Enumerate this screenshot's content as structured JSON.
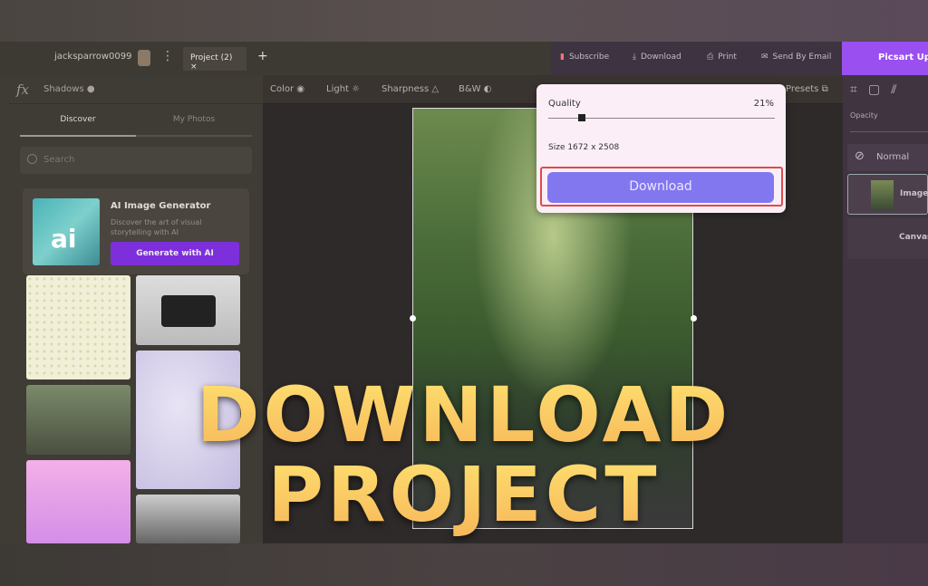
{
  "tabbar": {
    "username": "jacksparrow0099",
    "project_tab": "Project (2)",
    "close": "×",
    "new_tab": "+"
  },
  "actions": {
    "subscribe": "Subscribe",
    "download": "Download",
    "print": "Print",
    "send_email": "Send By Email",
    "upload": "Picsart Uplo"
  },
  "left": {
    "fx": "fx",
    "shadows": "Shadows",
    "tabs": [
      "Discover",
      "My Photos"
    ],
    "search_placeholder": "Search",
    "promo": {
      "badge": "ai",
      "title": "AI Image Generator",
      "desc": "Discover the art of visual storytelling with AI",
      "button": "Generate with AI"
    }
  },
  "adjust": {
    "color": "Color",
    "light": "Light",
    "sharpness": "Sharpness",
    "bw": "B&W",
    "presets": "Presets"
  },
  "popup": {
    "quality_label": "Quality",
    "quality_value": "21%",
    "quality_percent": 21,
    "size": "Size 1672 x 2508",
    "download": "Download"
  },
  "right": {
    "opacity": "Opacity",
    "blend": "Normal",
    "layers": [
      "Images",
      "Canvas"
    ]
  },
  "overlay": {
    "line1": "DOWNLOAD",
    "line2": "PROJECT"
  },
  "colors": {
    "accent": "#9a4ff0",
    "download_button": "#8277ef",
    "highlight": "#e04a4a",
    "overlay_text": "#ffd060"
  }
}
